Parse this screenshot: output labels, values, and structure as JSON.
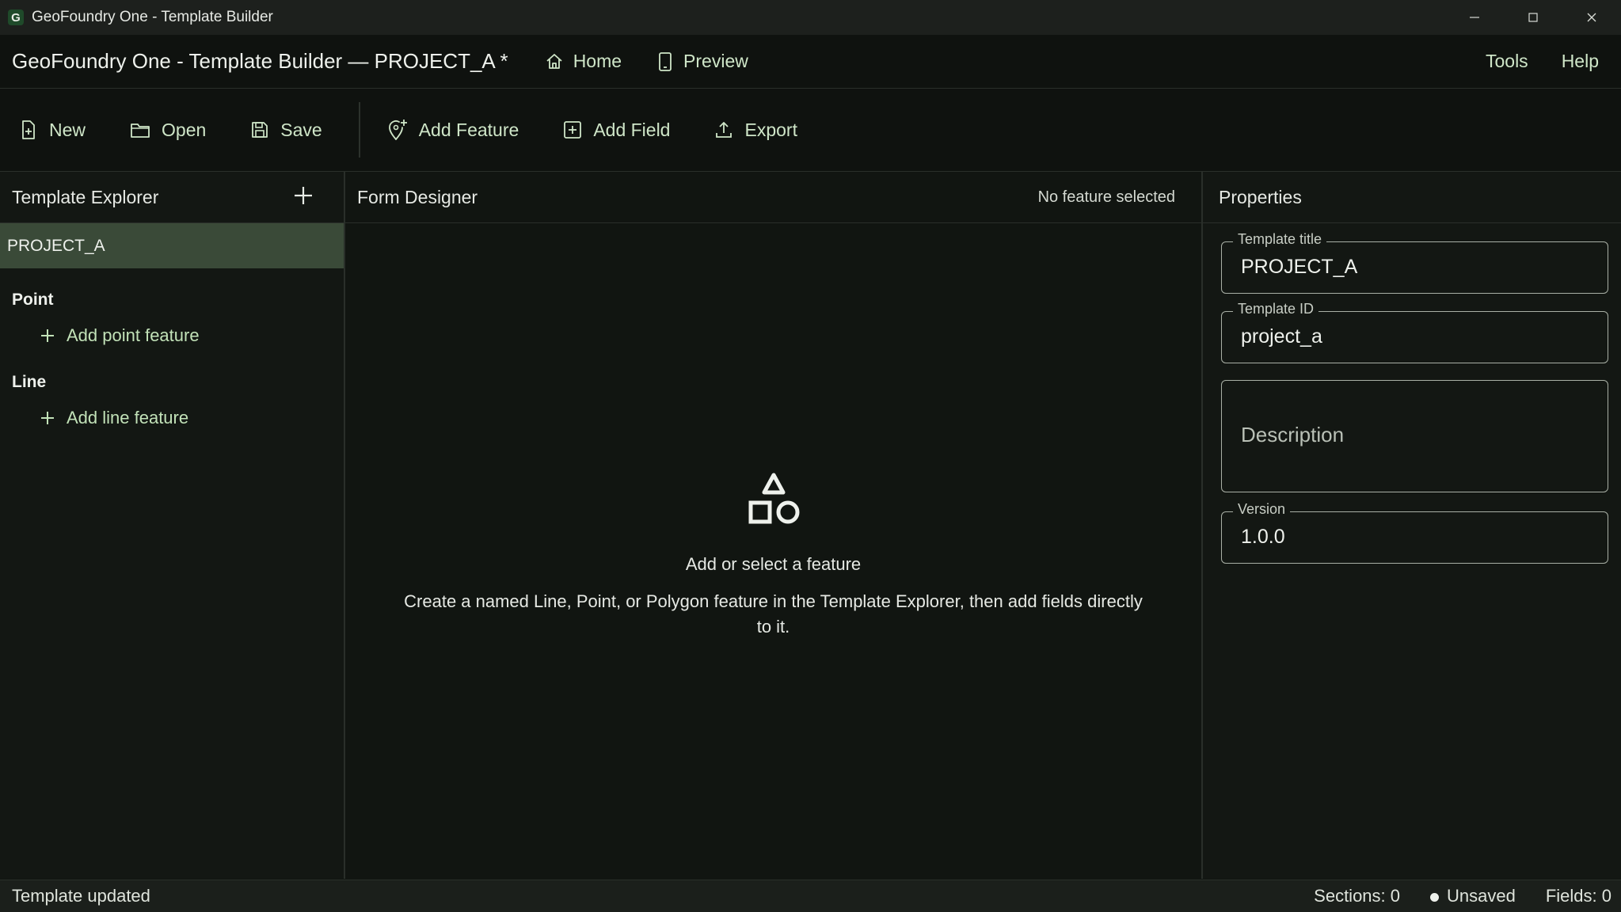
{
  "window": {
    "title": "GeoFoundry One - Template Builder",
    "app_icon_letter": "G"
  },
  "header": {
    "title": "GeoFoundry One - Template Builder — PROJECT_A *",
    "nav": {
      "home": "Home",
      "preview": "Preview"
    },
    "menu": {
      "tools": "Tools",
      "help": "Help"
    }
  },
  "toolbar": {
    "new": "New",
    "open": "Open",
    "save": "Save",
    "add_feature": "Add Feature",
    "add_field": "Add Field",
    "export": "Export"
  },
  "explorer": {
    "title": "Template Explorer",
    "project": "PROJECT_A",
    "groups": [
      {
        "label": "Point",
        "add_label": "Add point feature"
      },
      {
        "label": "Line",
        "add_label": "Add line feature"
      }
    ]
  },
  "designer": {
    "title": "Form Designer",
    "status": "No feature selected",
    "empty_title": "Add or select a feature",
    "empty_text": "Create a named Line, Point, or Polygon feature in the Template Explorer, then add fields directly to it."
  },
  "properties": {
    "title": "Properties",
    "template_title_label": "Template title",
    "template_title_value": "PROJECT_A",
    "template_id_label": "Template ID",
    "template_id_value": "project_a",
    "description_placeholder": "Description",
    "version_label": "Version",
    "version_value": "1.0.0"
  },
  "statusbar": {
    "message": "Template updated",
    "sections": "Sections: 0",
    "unsaved": "Unsaved",
    "fields": "Fields: 0"
  },
  "colors": {
    "accent": "#c2e2b8",
    "selection": "#3a4a38",
    "background": "#111511"
  }
}
